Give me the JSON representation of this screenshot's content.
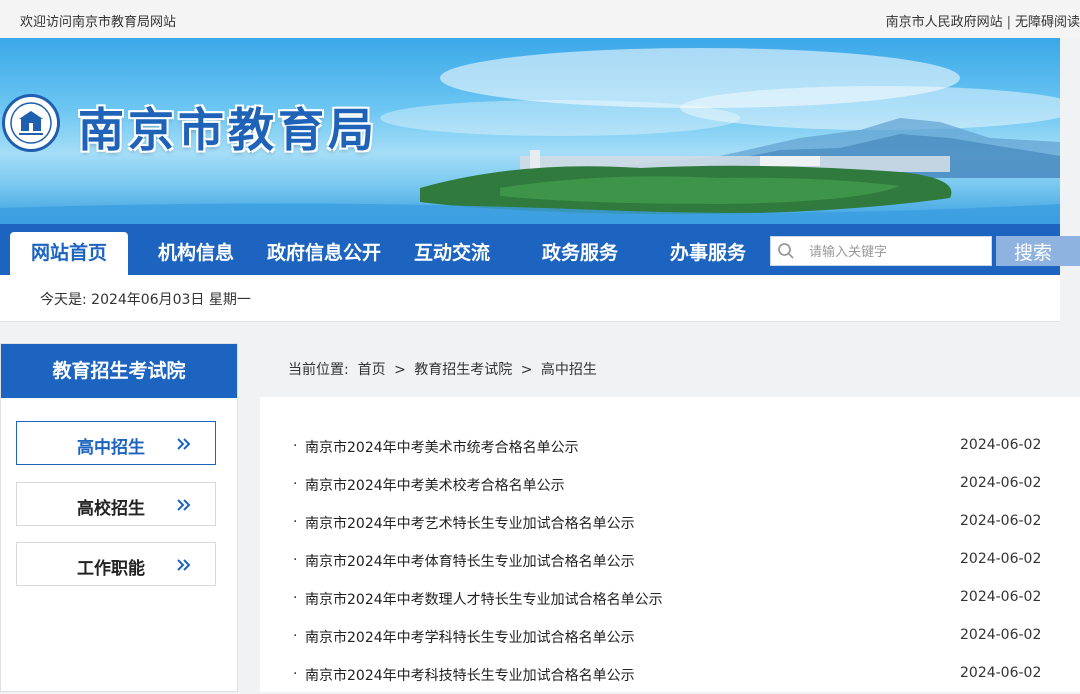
{
  "topbar": {
    "welcome": "欢迎访问南京市教育局网站",
    "gov_link": "南京市人民政府网站",
    "separator": "|",
    "accessible_link": "无障碍阅读"
  },
  "banner": {
    "title": "南京市教育局"
  },
  "nav": {
    "items": [
      {
        "label": "网站首页",
        "active": true
      },
      {
        "label": "机构信息"
      },
      {
        "label": "政府信息公开"
      },
      {
        "label": "互动交流"
      },
      {
        "label": "政务服务"
      },
      {
        "label": "办事服务"
      }
    ]
  },
  "search": {
    "placeholder": "请输入关键字",
    "button_label": "搜索"
  },
  "datebar": {
    "text": "今天是: 2024年06月03日 星期一"
  },
  "sidebar": {
    "title": "教育招生考试院",
    "items": [
      {
        "label": "高中招生",
        "active": true
      },
      {
        "label": "高校招生"
      },
      {
        "label": "工作职能"
      }
    ]
  },
  "breadcrumb": {
    "prefix": "当前位置:",
    "items": [
      "首页",
      "教育招生考试院",
      "高中招生"
    ],
    "separator": ">"
  },
  "news": {
    "bullet": "·",
    "items": [
      {
        "title": "南京市2024年中考美术市统考合格名单公示",
        "date": "2024-06-02"
      },
      {
        "title": "南京市2024年中考美术校考合格名单公示",
        "date": "2024-06-02"
      },
      {
        "title": "南京市2024年中考艺术特长生专业加试合格名单公示",
        "date": "2024-06-02"
      },
      {
        "title": "南京市2024年中考体育特长生专业加试合格名单公示",
        "date": "2024-06-02"
      },
      {
        "title": "南京市2024年中考数理人才特长生专业加试合格名单公示",
        "date": "2024-06-02"
      },
      {
        "title": "南京市2024年中考学科特长生专业加试合格名单公示",
        "date": "2024-06-02"
      },
      {
        "title": "南京市2024年中考科技特长生专业加试合格名单公示",
        "date": "2024-06-02"
      }
    ]
  },
  "colors": {
    "brand_blue": "#1d63c0",
    "search_button": "#8fb3e1"
  }
}
